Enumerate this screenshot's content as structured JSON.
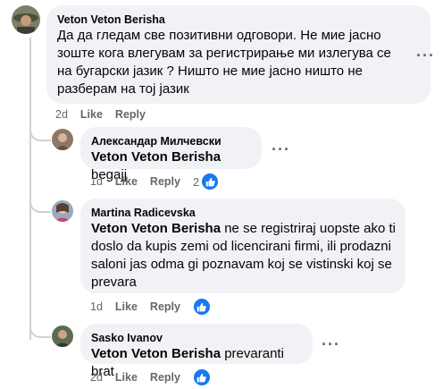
{
  "colors": {
    "bubble_bg": "#f0f2f5",
    "meta_text": "#65676b",
    "like_blue": "#1877f2"
  },
  "comments": [
    {
      "author": "Veton Veton Berisha",
      "text": "Да да гледам све позитивни одговори. Не мие јасно зоште кога влегувам за регистрирање ми излегува се на бугарски јазик ? Ништо не мие јасно ништо не разберам на тој јазик",
      "time": "2d",
      "like_label": "Like",
      "reply_label": "Reply"
    },
    {
      "author": "Александар Милчевски",
      "mention": "Veton Veton Berisha",
      "text": " begajj",
      "time": "1d",
      "like_label": "Like",
      "reply_label": "Reply",
      "reaction_count": "2",
      "reaction_icon": "like-icon"
    },
    {
      "author": "Martina Radicevska",
      "mention": "Veton Veton Berisha",
      "text": " ne se registriraj uopste ako ti doslo da kupis zemi od licencirani firmi, ili prodazni saloni jas odma gi poznavam koj se vistinski koj se prevara",
      "time": "1d",
      "like_label": "Like",
      "reply_label": "Reply",
      "reaction_icon": "like-icon"
    },
    {
      "author": "Sasko Ivanov",
      "mention": "Veton Veton Berisha",
      "text": " prevaranti brat",
      "time": "2d",
      "like_label": "Like",
      "reply_label": "Reply",
      "reaction_icon": "like-icon"
    }
  ]
}
